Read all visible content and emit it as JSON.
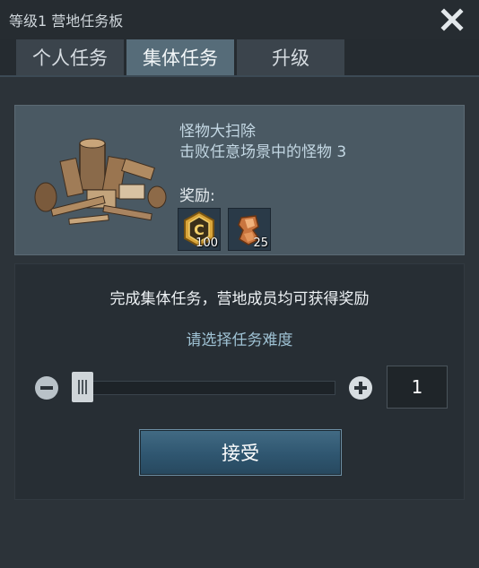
{
  "window": {
    "title": "等级1 营地任务板"
  },
  "tabs": [
    {
      "label": "个人任务",
      "active": false
    },
    {
      "label": "集体任务",
      "active": true
    },
    {
      "label": "升级",
      "active": false
    }
  ],
  "task": {
    "name": "怪物大扫除",
    "description": "击败任意场景中的怪物 3",
    "reward_label": "奖励:",
    "rewards": [
      {
        "icon": "gold-coin-icon",
        "count": "100"
      },
      {
        "icon": "copper-ore-icon",
        "count": "25"
      }
    ]
  },
  "panel": {
    "title": "完成集体任务，营地成员均可获得奖励",
    "subtitle": "请选择任务难度",
    "difficulty_value": "1",
    "slider_level": 0,
    "accept_label": "接受"
  },
  "colors": {
    "background": "#2c3339",
    "active_tab": "#566c79",
    "task_card": "#4a5963",
    "accent_text": "#9fc2d4"
  }
}
